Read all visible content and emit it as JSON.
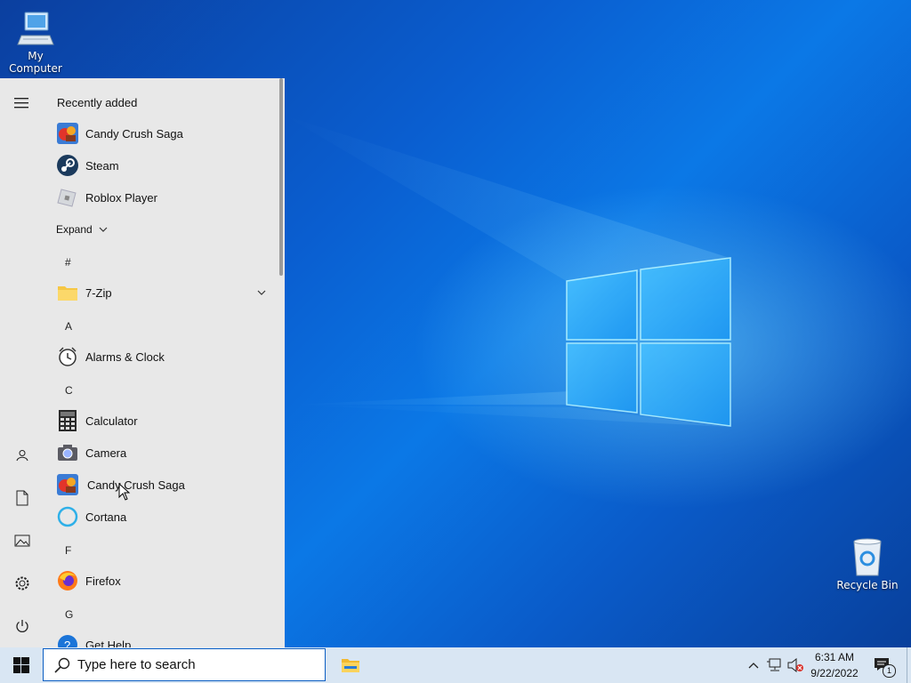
{
  "desktop": {
    "icons": [
      {
        "label": "My Computer",
        "icon": "computer-icon"
      },
      {
        "label": "Recycle Bin",
        "icon": "recycle-bin-icon"
      }
    ]
  },
  "start_menu": {
    "section_title": "Recently added",
    "recent": [
      {
        "label": "Candy Crush Saga",
        "icon": "candy-crush-icon"
      },
      {
        "label": "Steam",
        "icon": "steam-icon"
      },
      {
        "label": "Roblox Player",
        "icon": "roblox-icon"
      }
    ],
    "expand_label": "Expand",
    "groups": {
      "hash": "#",
      "a": "A",
      "c": "C",
      "f": "F",
      "g": "G"
    },
    "apps": {
      "zip": "7-Zip",
      "alarms": "Alarms & Clock",
      "calculator": "Calculator",
      "camera": "Camera",
      "candy": "Candy Crush Saga",
      "cortana": "Cortana",
      "firefox": "Firefox",
      "gethelp": "Get Help"
    },
    "rail_icons": [
      "hamburger-menu-icon",
      "user-icon",
      "documents-icon",
      "pictures-icon",
      "settings-icon",
      "power-icon"
    ]
  },
  "taskbar": {
    "search_placeholder": "Type here to search",
    "clock_time": "6:31 AM",
    "clock_date": "9/22/2022",
    "notification_count": "1"
  }
}
